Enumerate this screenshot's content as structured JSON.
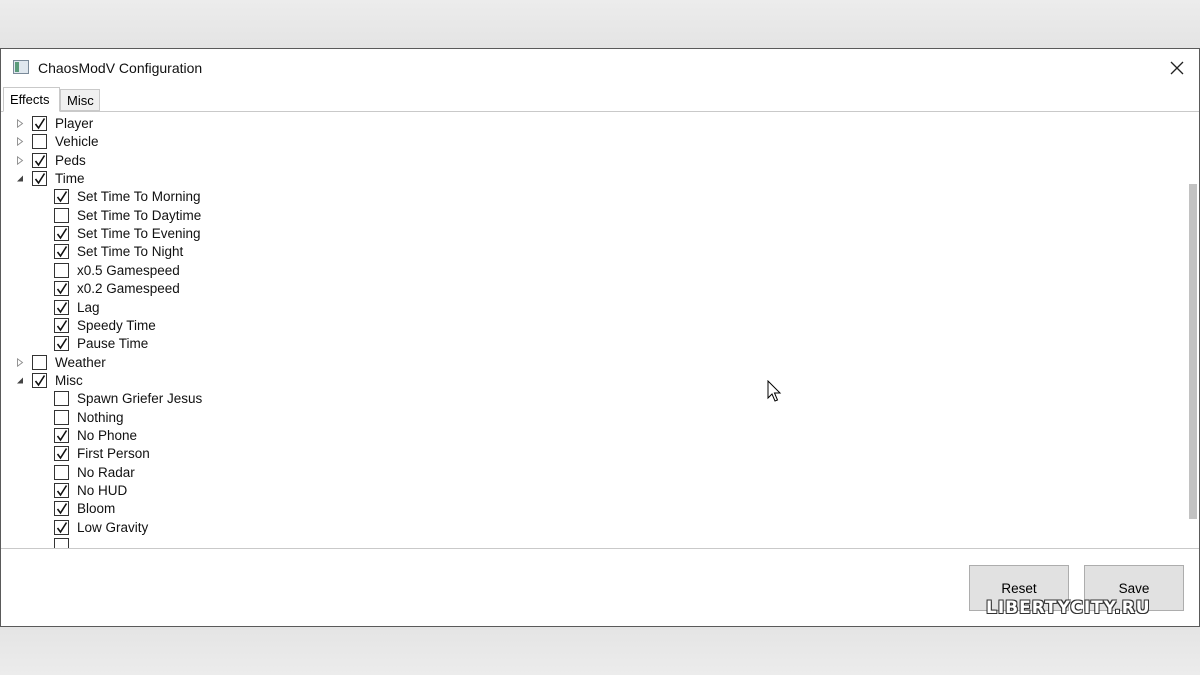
{
  "window": {
    "title": "ChaosModV Configuration"
  },
  "tabs": [
    {
      "label": "Effects",
      "active": true
    },
    {
      "label": "Misc",
      "active": false
    }
  ],
  "tree": [
    {
      "label": "Player",
      "checked": true,
      "level": 0,
      "expander": "collapsed"
    },
    {
      "label": "Vehicle",
      "checked": false,
      "level": 0,
      "expander": "collapsed"
    },
    {
      "label": "Peds",
      "checked": true,
      "level": 0,
      "expander": "collapsed"
    },
    {
      "label": "Time",
      "checked": true,
      "level": 0,
      "expander": "expanded"
    },
    {
      "label": "Set Time To Morning",
      "checked": true,
      "level": 1
    },
    {
      "label": "Set Time To Daytime",
      "checked": false,
      "level": 1
    },
    {
      "label": "Set Time To Evening",
      "checked": true,
      "level": 1
    },
    {
      "label": "Set Time To Night",
      "checked": true,
      "level": 1
    },
    {
      "label": "x0.5 Gamespeed",
      "checked": false,
      "level": 1
    },
    {
      "label": "x0.2 Gamespeed",
      "checked": true,
      "level": 1
    },
    {
      "label": "Lag",
      "checked": true,
      "level": 1
    },
    {
      "label": "Speedy Time",
      "checked": true,
      "level": 1
    },
    {
      "label": "Pause Time",
      "checked": true,
      "level": 1
    },
    {
      "label": "Weather",
      "checked": false,
      "level": 0,
      "expander": "collapsed"
    },
    {
      "label": "Misc",
      "checked": true,
      "level": 0,
      "expander": "expanded"
    },
    {
      "label": "Spawn Griefer Jesus",
      "checked": false,
      "level": 1
    },
    {
      "label": "Nothing",
      "checked": false,
      "level": 1
    },
    {
      "label": "No Phone",
      "checked": true,
      "level": 1
    },
    {
      "label": "First Person",
      "checked": true,
      "level": 1
    },
    {
      "label": "No Radar",
      "checked": false,
      "level": 1
    },
    {
      "label": "No HUD",
      "checked": true,
      "level": 1
    },
    {
      "label": "Bloom",
      "checked": true,
      "level": 1
    },
    {
      "label": "Low Gravity",
      "checked": true,
      "level": 1
    },
    {
      "label": "",
      "checked": false,
      "level": 1
    }
  ],
  "buttons": {
    "reset": "Reset",
    "save": "Save"
  },
  "watermark": "LIBERTYCITY.RU",
  "colors": {
    "window_border": "#5a5a5a",
    "button_bg": "#e1e1e1",
    "scrollbar": "#c2c2c2"
  }
}
